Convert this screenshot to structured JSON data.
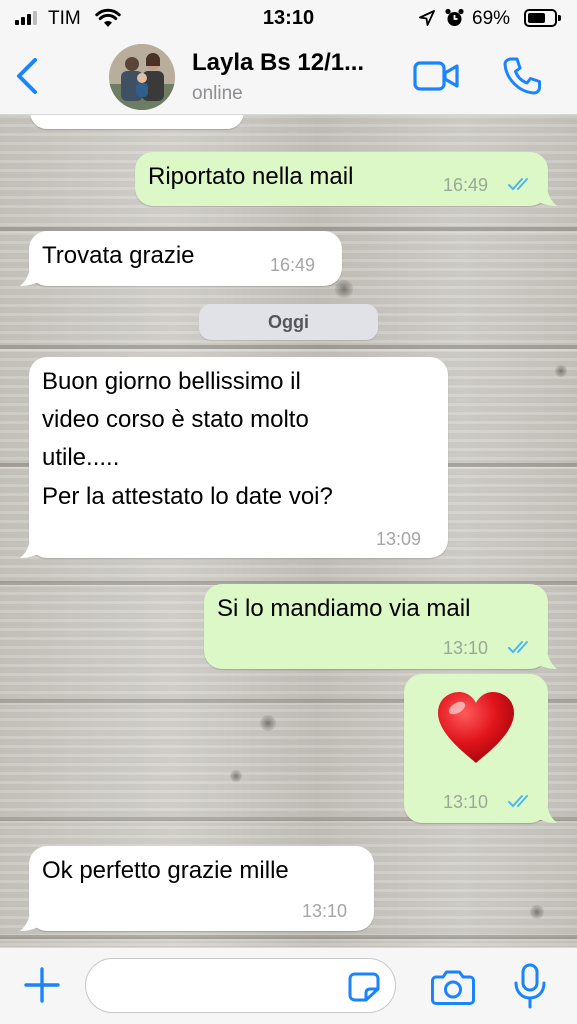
{
  "status_bar": {
    "carrier": "TIM",
    "time": "13:10",
    "battery_percent": "69%",
    "battery_level": 0.69,
    "icons": [
      "signal-icon",
      "wifi-icon",
      "location-arrow-icon",
      "alarm-icon",
      "battery-icon"
    ]
  },
  "header": {
    "back_icon": "chevron-left-icon",
    "contact_name": "Layla Bs 12/1...",
    "contact_status": "online",
    "video_icon": "video-camera-icon",
    "phone_icon": "phone-icon"
  },
  "chat": {
    "date_separator": "Oggi",
    "messages": [
      {
        "direction": "outgoing",
        "text": "Riportato nella mail",
        "time": "16:49",
        "read": true
      },
      {
        "direction": "incoming",
        "text": "Trovata grazie",
        "time": "16:49"
      },
      {
        "direction": "incoming",
        "lines": [
          "Buon giorno bellissimo il",
          "video corso è stato molto",
          "utile.....",
          "Per la attestato lo date voi?"
        ],
        "time": "13:09"
      },
      {
        "direction": "outgoing",
        "text": "Si lo mandiamo via mail",
        "time": "13:10",
        "read": true
      },
      {
        "direction": "outgoing",
        "emoji": "heart",
        "time": "13:10",
        "read": true
      },
      {
        "direction": "incoming",
        "text": "Ok perfetto grazie mille",
        "time": "13:10"
      }
    ]
  },
  "input_bar": {
    "placeholder": "",
    "icons": [
      "plus-icon",
      "sticker-icon",
      "camera-icon",
      "microphone-icon"
    ]
  },
  "colors": {
    "accent": "#1a84ff",
    "outgoing_bubble": "#dcf8c6",
    "incoming_bubble": "#ffffff",
    "read_ticks": "#4fb6ec",
    "bar_background": "#f6f6f6"
  }
}
